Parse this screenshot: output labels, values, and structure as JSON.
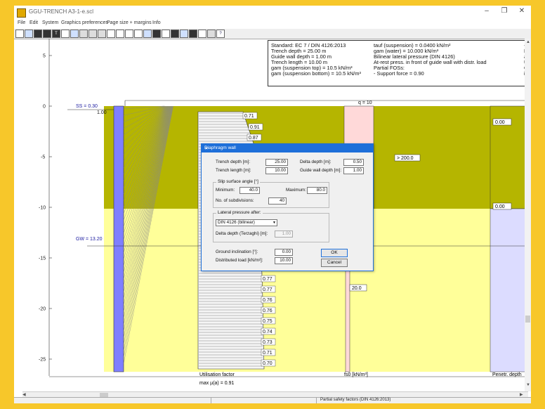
{
  "window": {
    "title": "GGU-TRENCH A3-1-e.scl",
    "controls": [
      "–",
      "❐",
      "✕"
    ]
  },
  "menu": [
    "File",
    "Edit",
    "System",
    "Graphics preferences",
    "Page size + margins",
    "Info"
  ],
  "toolbar_icons": [
    "new-icon",
    "open-icon",
    "save-icon",
    "print-setup-icon",
    "font-icon",
    "print-icon",
    "copy-icon",
    "move-icon",
    "zoom-icon",
    "zoom-window-icon",
    "zoom-in-icon",
    "zoom-out-icon",
    "zoom-full-icon",
    "ruler-icon",
    "edit-icon",
    "table-icon",
    "clipboard-icon",
    "info-icon",
    "drawing-icon",
    "color-icon",
    "refresh-icon",
    "undo-icon",
    "help-icon"
  ],
  "info_panel": {
    "col1": [
      "Standard:  EC 7 / DIN 4126:2013",
      "Trench depth = 25.00 m",
      "Guide wall depth = 1.00 m",
      "Trench length = 10.00 m",
      "gam (suspension top) = 10.5 kN/m³",
      "gam (suspension bottom) = 10.5 kN/m³"
    ],
    "col2": [
      "tauf (suspension) = 0.0400 kN/m²",
      "gam (water) = 10.000 kN/m³",
      "Bilinear lateral pressure (DIN 4126)",
      "At-rest press. in front of guide wall with distr. load",
      "Partial FOSs:",
      " - Support force = 0.90"
    ],
    "col3": [
      "-",
      "M",
      "at",
      "U",
      "G",
      "in"
    ]
  },
  "drawing": {
    "y_ticks": [
      "5",
      "0",
      "-5",
      "-10",
      "-15",
      "-20",
      "-25"
    ],
    "ss_label": "SS = 0.30",
    "guide_label": "1.00",
    "gw_label": "GW = 13.20",
    "load_label": "q = 10",
    "util_values": [
      "0.71",
      "0.91",
      "0.87",
      "0.77",
      "0.77",
      "0.76",
      "0.76",
      "0.75",
      "0.74",
      "0.73",
      "0.71",
      "0.70"
    ],
    "fs0_values": [
      "> 200.0",
      "20.0"
    ],
    "penetr_values": [
      "0.00",
      "0.00"
    ],
    "bottom_util_label": "Utilisation factor",
    "bottom_util_max": "max µ(a) = 0.91",
    "bottom_fs0_label": "fs0 [kN/m³]",
    "bottom_penetr_label": "Penetr. depth",
    "colors": {
      "upper_soil": "#b5b500",
      "lower_soil": "#ffff99",
      "trench": "#7f7fff",
      "fs0_bar": "#ffd9d9",
      "penetr": "#dcdcff"
    }
  },
  "dialog": {
    "title": "Diaphragm wall",
    "close": "✕",
    "trench_depth_label": "Trench depth [m]:",
    "trench_depth": "25.00",
    "delta_depth_label": "Delta depth [m]:",
    "delta_depth": "0.50",
    "trench_length_label": "Trench length [m]:",
    "trench_length": "10.00",
    "guide_wall_label": "Guide wall depth [m]:",
    "guide_wall": "1.00",
    "slip_group": "Slip surface angle [°]",
    "min_label": "Minimum:",
    "min": "40.0",
    "max_label": "Maximum:",
    "max": "80.0",
    "subdiv_label": "No. of subdivisions:",
    "subdiv": "40",
    "lateral_group": "Lateral pressure after:",
    "lateral_select": "DIN 4126 (bilinear)",
    "terzaghi_label": "Delta depth (Terzaghi) [m]:",
    "terzaghi": "1.00",
    "ground_label": "Ground inclination [°]:",
    "ground": "0.00",
    "load_label": "Distributed load [kN/m²]:",
    "load": "10.00",
    "ok": "OK",
    "cancel": "Cancel"
  },
  "status": {
    "text": "Partial safety factors (DIN 4126:2013)"
  }
}
